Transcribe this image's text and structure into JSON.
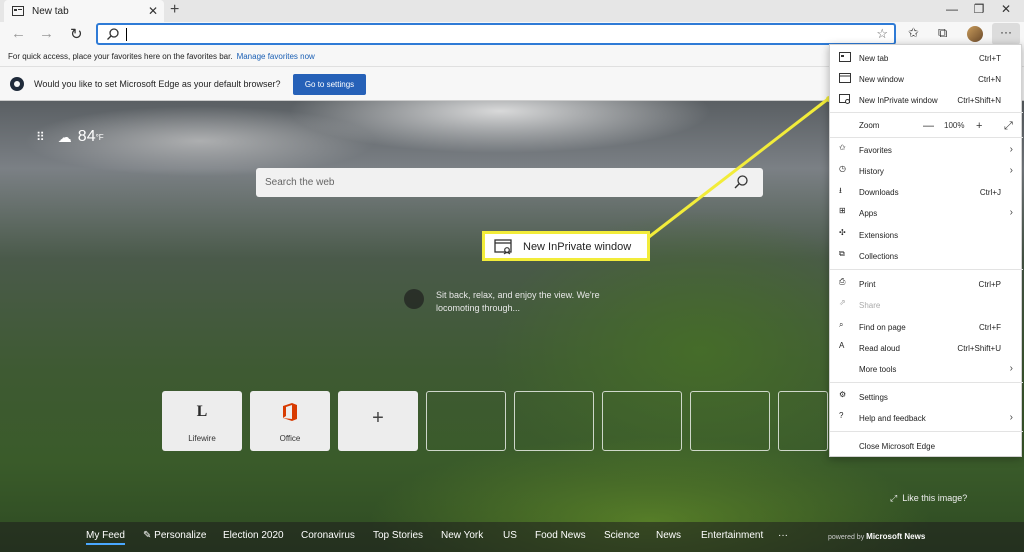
{
  "tab": {
    "title": "New tab"
  },
  "favorites_bar": {
    "text": "For quick access, place your favorites here on the favorites bar.",
    "link": "Manage favorites now"
  },
  "default_bar": {
    "message": "Would you like to set Microsoft Edge as your default browser?",
    "button": "Go to settings"
  },
  "weather": {
    "temp": "84",
    "unit": "°F"
  },
  "search": {
    "placeholder": "Search the web"
  },
  "callout": {
    "label": "New InPrivate window"
  },
  "image_info": {
    "line1": "Sit back, relax, and enjoy the view. We're",
    "line2": "locomoting through..."
  },
  "quick_links": [
    {
      "label": "Lifewire",
      "logo": "L"
    },
    {
      "label": "Office",
      "logo": "O"
    }
  ],
  "like_image": "Like this image?",
  "feed": {
    "items": [
      "My Feed",
      "Personalize",
      "Election 2020",
      "Coronavirus",
      "Top Stories",
      "New York",
      "US",
      "Food News",
      "Science",
      "News",
      "Entertainment",
      "···"
    ],
    "powered_by": "powered by",
    "powered_brand": "Microsoft News"
  },
  "menu": {
    "new_tab": {
      "label": "New tab",
      "shortcut": "Ctrl+T"
    },
    "new_window": {
      "label": "New window",
      "shortcut": "Ctrl+N"
    },
    "new_inprivate": {
      "label": "New InPrivate window",
      "shortcut": "Ctrl+Shift+N"
    },
    "zoom": {
      "label": "Zoom",
      "minus": "—",
      "value": "100%",
      "plus": "+"
    },
    "favorites": {
      "label": "Favorites"
    },
    "history": {
      "label": "History"
    },
    "downloads": {
      "label": "Downloads",
      "shortcut": "Ctrl+J"
    },
    "apps": {
      "label": "Apps"
    },
    "extensions": {
      "label": "Extensions"
    },
    "collections": {
      "label": "Collections"
    },
    "print": {
      "label": "Print",
      "shortcut": "Ctrl+P"
    },
    "share": {
      "label": "Share"
    },
    "find": {
      "label": "Find on page",
      "shortcut": "Ctrl+F"
    },
    "read_aloud": {
      "label": "Read aloud",
      "shortcut": "Ctrl+Shift+U"
    },
    "more_tools": {
      "label": "More tools"
    },
    "settings": {
      "label": "Settings"
    },
    "help": {
      "label": "Help and feedback"
    },
    "close": {
      "label": "Close Microsoft Edge"
    }
  },
  "colors": {
    "accent": "#2661b8",
    "highlight": "#f2ec3a",
    "link": "#1a5fb4"
  }
}
